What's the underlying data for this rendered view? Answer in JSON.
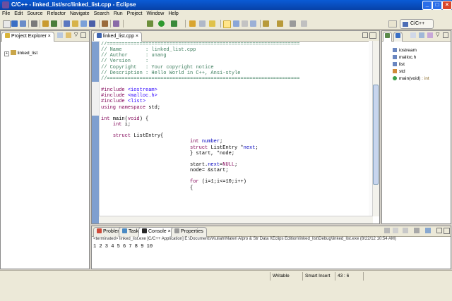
{
  "window": {
    "title": "C/C++ - linked_list/src/linked_list.cpp - Eclipse"
  },
  "menu": [
    "File",
    "Edit",
    "Source",
    "Refactor",
    "Navigate",
    "Search",
    "Run",
    "Project",
    "Window",
    "Help"
  ],
  "perspective": {
    "label": "C/C++"
  },
  "project_explorer": {
    "tab_label": "Project Explorer",
    "items": [
      {
        "label": "linked_list",
        "icon": "project-folder-icon"
      }
    ]
  },
  "editor": {
    "tab_label": "linked_list.cpp",
    "lines": [
      "//=================================================================",
      "// Name        : linked_list.cpp",
      "// Author      : unang",
      "// Version     :",
      "// Copyright   : Your copyright notice",
      "// Description : Hello World in C++, Ansi-style",
      "//=================================================================",
      "",
      "#include <iostream>",
      "#include <malloc.h>",
      "#include <list>",
      "using namespace std;",
      "",
      "int main(void) {",
      "    int i;",
      "",
      "    struct ListEntry{",
      "                              int number;",
      "                              struct ListEntry *next;",
      "                              } start, *node;",
      "",
      "                              start.next=NULL;",
      "                              node= &start;",
      "",
      "                              for (i=1;i<=10;i++)",
      "                              {"
    ]
  },
  "outline": {
    "items": [
      {
        "label": "iostream",
        "icon": "include-icon"
      },
      {
        "label": "malloc.h",
        "icon": "include-icon"
      },
      {
        "label": "list",
        "icon": "include-icon"
      },
      {
        "label": "std",
        "icon": "namespace-icon"
      },
      {
        "label": "main(void)",
        "suffix": " : int",
        "icon": "function-icon"
      }
    ]
  },
  "bottom_panel": {
    "tabs": [
      "Problems",
      "Tasks",
      "Console",
      "Properties"
    ],
    "active_tab": "Console",
    "console_header": "<terminated> linked_list.exe [C/C++ Application] E:\\Documents\\Kuliah\\Materi Alpro & Str Data I\\Eclips Edition\\linked_list\\Debug\\linked_list.exe (8/22/12 10:54 AM)",
    "console_output": "1 2 3 4 5 6 7 8 9 10"
  },
  "status_bar": {
    "mode": "Writable",
    "insert": "Smart Insert",
    "position": "43 : 6"
  },
  "colors": {
    "title_bar": "#0a5bd6",
    "chrome": "#ece9d8",
    "comment": "#3f7f5f",
    "keyword": "#7f0055",
    "string": "#2a00ff"
  }
}
